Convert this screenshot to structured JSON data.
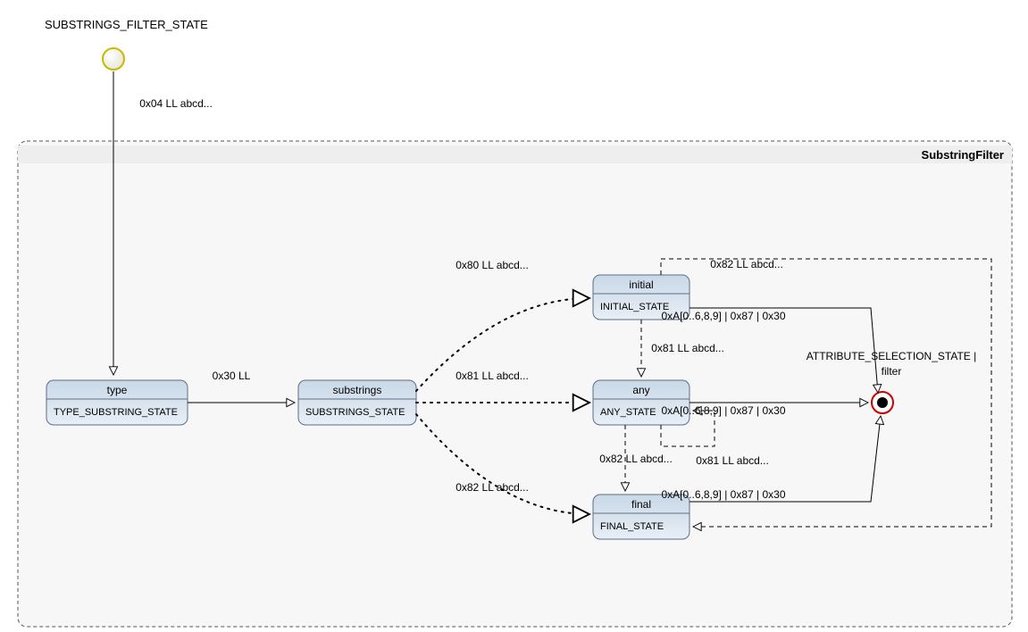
{
  "diagram": {
    "outer_label": "SUBSTRINGS_FILTER_STATE",
    "frame_label": "SubstringFilter",
    "attribute_state_label_1": "ATTRIBUTE_SELECTION_STATE |",
    "attribute_state_label_2": "filter"
  },
  "states": {
    "type": {
      "title": "type",
      "sub": "TYPE_SUBSTRING_STATE"
    },
    "substrings": {
      "title": "substrings",
      "sub": "SUBSTRINGS_STATE"
    },
    "initial": {
      "title": "initial",
      "sub": "INITIAL_STATE"
    },
    "any": {
      "title": "any",
      "sub": "ANY_STATE"
    },
    "final": {
      "title": "final",
      "sub": "FINAL_STATE"
    }
  },
  "edges": {
    "start_to_type": "0x04 LL abcd...",
    "type_to_substrings": "0x30 LL",
    "sub_to_initial": "0x80 LL abcd...",
    "sub_to_any": "0x81 LL abcd...",
    "sub_to_final": "0x82 LL abcd...",
    "initial_to_any": "0x81 LL abcd...",
    "any_to_final": "0x82 LL abcd...",
    "any_self": "0x81 LL abcd...",
    "initial_top": "0x82 LL abcd...",
    "initial_to_exit": "0xA[0..6,8,9] | 0x87 | 0x30",
    "any_to_exit": "0xA[0..6,8,9] | 0x87 | 0x30",
    "final_to_exit": "0xA[0..6,8,9] | 0x87 | 0x30"
  }
}
